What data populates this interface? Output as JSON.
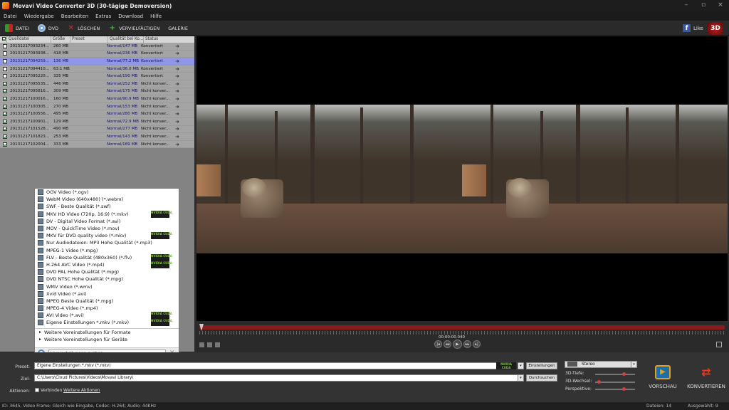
{
  "app": {
    "title": "Movavi Video Converter 3D (30-tägige Demoversion)"
  },
  "menu": [
    "Datei",
    "Wiedergabe",
    "Bearbeiten",
    "Extras",
    "Download",
    "Hilfe"
  ],
  "toolbar": {
    "datei": "DATEI",
    "dvd": "DVD",
    "loeschen": "LÖSCHEN",
    "vervielfaeltigen": "VERVIELFÄLTIGEN",
    "galerie": "GALERIE",
    "like": "Like",
    "badge": "3D"
  },
  "table": {
    "headers": [
      "Quelldatei",
      "Größe",
      "Preset",
      "Qualität bei Ko...",
      "Status"
    ],
    "rows": [
      {
        "name": "20131217093234...",
        "size": "260 MB",
        "quality": "Normal/147 MB",
        "status": "Konvertiert",
        "checked": false,
        "selected": false
      },
      {
        "name": "20131217093938...",
        "size": "418 MB",
        "quality": "Normal/236 MB",
        "status": "Konvertiert",
        "checked": false,
        "selected": false
      },
      {
        "name": "20131217094259...",
        "size": "136 MB",
        "quality": "Normal/77.2 MB",
        "status": "Konvertiert",
        "checked": false,
        "selected": true
      },
      {
        "name": "20131217094410...",
        "size": "63.1 MB",
        "quality": "Normal/36.0 MB",
        "status": "Konvertiert",
        "checked": false,
        "selected": false
      },
      {
        "name": "20131217095220...",
        "size": "335 MB",
        "quality": "Normal/190 MB",
        "status": "Konvertiert",
        "checked": false,
        "selected": false
      },
      {
        "name": "20131217095535...",
        "size": "446 MB",
        "quality": "Normal/252 MB",
        "status": "Nicht konver...",
        "checked": true,
        "selected": false
      },
      {
        "name": "20131217095816...",
        "size": "309 MB",
        "quality": "Normal/175 MB",
        "status": "Nicht konver...",
        "checked": true,
        "selected": false
      },
      {
        "name": "20131217100016...",
        "size": "160 MB",
        "quality": "Normal/90.9 MB",
        "status": "Nicht konver...",
        "checked": true,
        "selected": false
      },
      {
        "name": "20131217100305...",
        "size": "270 MB",
        "quality": "Normal/153 MB",
        "status": "Nicht konver...",
        "checked": true,
        "selected": false
      },
      {
        "name": "20131217100556...",
        "size": "495 MB",
        "quality": "Normal/280 MB",
        "status": "Nicht konver...",
        "checked": true,
        "selected": false
      },
      {
        "name": "20131217100901...",
        "size": "129 MB",
        "quality": "Normal/72.9 MB",
        "status": "Nicht konver...",
        "checked": true,
        "selected": false
      },
      {
        "name": "20131217101528...",
        "size": "490 MB",
        "quality": "Normal/277 MB",
        "status": "Nicht konver...",
        "checked": true,
        "selected": false
      },
      {
        "name": "20131217101823...",
        "size": "253 MB",
        "quality": "Normal/143 MB",
        "status": "Nicht konver...",
        "checked": true,
        "selected": false
      },
      {
        "name": "20131217102004...",
        "size": "333 MB",
        "quality": "Normal/189 MB",
        "status": "Nicht konver...",
        "checked": true,
        "selected": false
      }
    ]
  },
  "formats": [
    {
      "label": "OGV Video (*.ogv)",
      "cuda": false
    },
    {
      "label": "WebM Video (640x480) (*.webm)",
      "cuda": false
    },
    {
      "label": "SWF - Beste Qualität (*.swf)",
      "cuda": false
    },
    {
      "label": "MKV HD Video (720p, 16:9) (*.mkv)",
      "cuda": true
    },
    {
      "label": "DV - Digital Video Format (*.avi)",
      "cuda": false
    },
    {
      "label": "MOV - QuickTime Video (*.mov)",
      "cuda": false
    },
    {
      "label": "MKV für DVD quality video (*.mkv)",
      "cuda": true
    },
    {
      "label": "Nur Audiodateien: MP3 Hohe Qualität (*.mp3)",
      "cuda": false
    },
    {
      "label": "MPEG-1 Video (*.mpg)",
      "cuda": false
    },
    {
      "label": "FLV - Beste Qualität (480x360) (*.flv)",
      "cuda": true
    },
    {
      "label": "H.264 AVC Video (*.mp4)",
      "cuda": true
    },
    {
      "label": "DVD PAL Hohe Qualität (*.mpg)",
      "cuda": false
    },
    {
      "label": "DVD NTSC Hohe Qualität (*.mpg)",
      "cuda": false
    },
    {
      "label": "WMV Video (*.wmv)",
      "cuda": false
    },
    {
      "label": "Xvid Video (*.avi)",
      "cuda": false
    },
    {
      "label": "MPEG Beste Qualität (*.mpg)",
      "cuda": false
    },
    {
      "label": "MPEG-4 Video (*.mp4)",
      "cuda": false
    },
    {
      "label": "AVI Video (*.avi)",
      "cuda": true
    },
    {
      "label": "Eigene Einstellungen *.mkv (*.mkv)",
      "cuda": true
    }
  ],
  "cuda_label": "NVIDIA CUDA",
  "format_more": [
    "Weitere Voreinstellungen für Formate",
    "Weitere Voreinstellungen für Geräte"
  ],
  "format_search": {
    "placeholder": "Voreinstellungen suchen"
  },
  "player": {
    "timecode": "00:00:00.040"
  },
  "bottom": {
    "preset_label": "Preset:",
    "preset_value": "Eigene Einstellungen *.mkv (*.mkv)",
    "settings_button": "Einstellungen",
    "target_label": "Ziel:",
    "target_value": "C:\\Users\\Cloud Pictures\\Videos\\Movavi Library\\",
    "browse_button": "Durchsuchen",
    "actions_label": "Aktionen:",
    "merge_label": "Verbinden",
    "more_actions": "Weitere Aktionen",
    "stereo_value": "Stereo",
    "depth_label": "3D-Tiefe:",
    "shift_label": "3D-Wechsel:",
    "perspective_label": "Perspektive:",
    "depth": 0.75,
    "shift": 0.05,
    "perspective": 0.75,
    "preview_button": "VORSCHAU",
    "convert_button": "KONVERTIEREN"
  },
  "status": {
    "info": "ID: 3645, Video Frame: Gleich wie Eingabe, Codec: H.264; Audio: 44KHz",
    "files": "Dateien: 14",
    "selected": "Ausgewählt: 9"
  },
  "colors": {
    "accent_red": "#8c1c1c",
    "selected_row": "#8f96e8"
  }
}
